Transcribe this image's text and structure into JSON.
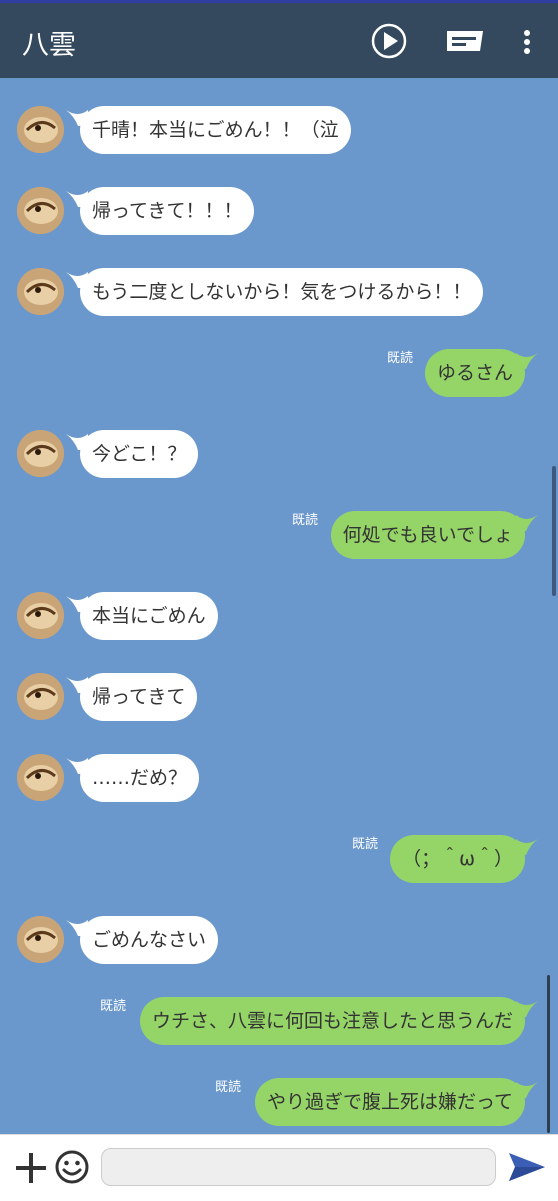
{
  "header": {
    "title": "八雲",
    "icons": [
      "play-icon",
      "keyboard-icon",
      "more-icon"
    ]
  },
  "messages": [
    {
      "side": "in",
      "text": "千晴！本当にごめん！！（泣"
    },
    {
      "side": "in",
      "text": "帰ってきて！！！"
    },
    {
      "side": "in",
      "text": "もう二度としないから！気をつけるから！！"
    },
    {
      "side": "out",
      "text": "ゆるさん",
      "read": "既読"
    },
    {
      "side": "in",
      "text": "今どこ！？"
    },
    {
      "side": "out",
      "text": "何処でも良いでしょ",
      "read": "既読"
    },
    {
      "side": "in",
      "text": "本当にごめん"
    },
    {
      "side": "in",
      "text": "帰ってきて"
    },
    {
      "side": "in",
      "text": "……だめ？"
    },
    {
      "side": "out",
      "text": "（；＾ω＾）",
      "read": "既読"
    },
    {
      "side": "in",
      "text": "ごめんなさい"
    },
    {
      "side": "out",
      "text": "ウチさ、八雲に何回も注意したと思うんだ",
      "read": "既読"
    },
    {
      "side": "out",
      "text": "やり過ぎで腹上死は嫌だって",
      "read": "既読"
    }
  ],
  "composer": {
    "placeholder": "",
    "icons": [
      "plus-icon",
      "emoji-icon",
      "send-icon"
    ]
  },
  "colors": {
    "header_bg": "#34495e",
    "chat_bg": "#6b98cc",
    "incoming_bubble": "#ffffff",
    "outgoing_bubble": "#95d568",
    "send_icon": "#3a5fb5"
  }
}
